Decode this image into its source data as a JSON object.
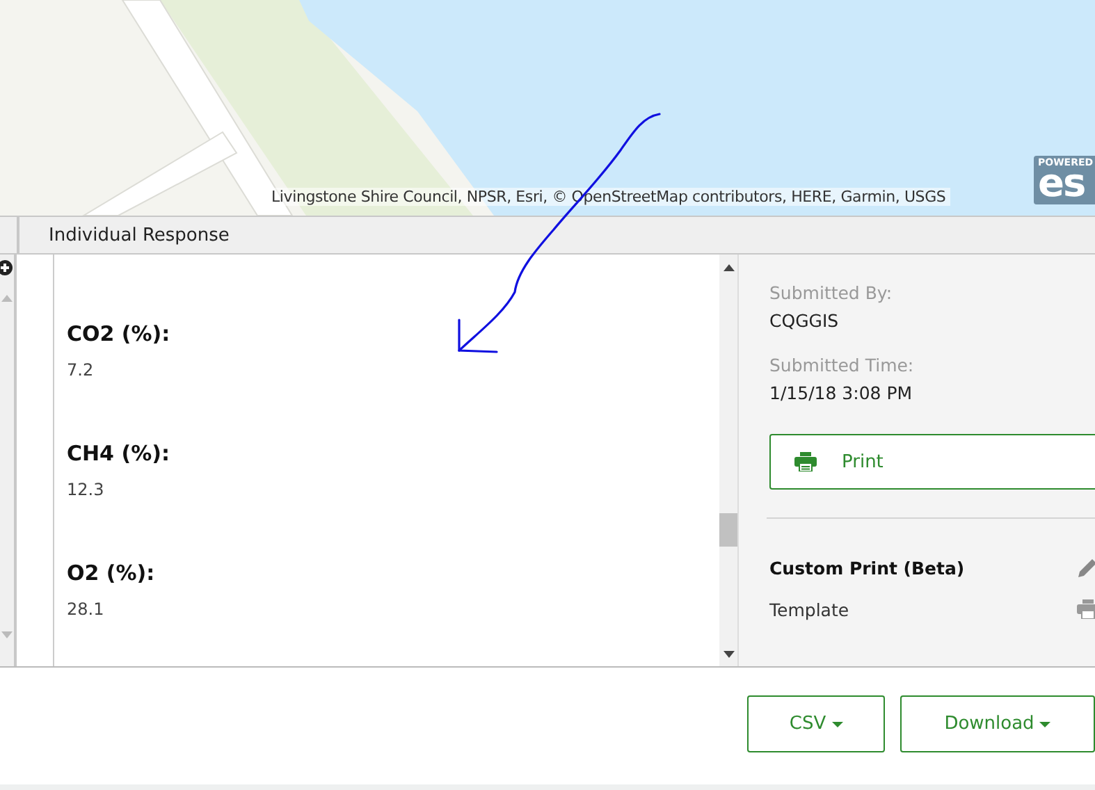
{
  "map": {
    "attribution": "Livingstone Shire Council, NPSR, Esri, © OpenStreetMap contributors, HERE, Garmin, USGS",
    "logo_top": "POWERED",
    "logo": "es"
  },
  "panel": {
    "title": "Individual Response",
    "fields": [
      {
        "label": "CO2 (%):",
        "value": "7.2"
      },
      {
        "label": "CH4 (%):",
        "value": "12.3"
      },
      {
        "label": "O2 (%):",
        "value": "28.1"
      }
    ],
    "info": [
      {
        "label": "Submitted By:",
        "value": "CQGGIS"
      },
      {
        "label": "Submitted Time:",
        "value": "1/15/18 3:08 PM"
      }
    ],
    "print_button": "Print",
    "custom_print": {
      "title": "Custom Print (Beta)",
      "template": "Template"
    }
  },
  "buttons": [
    {
      "label": "CSV"
    },
    {
      "label": "Download"
    }
  ]
}
